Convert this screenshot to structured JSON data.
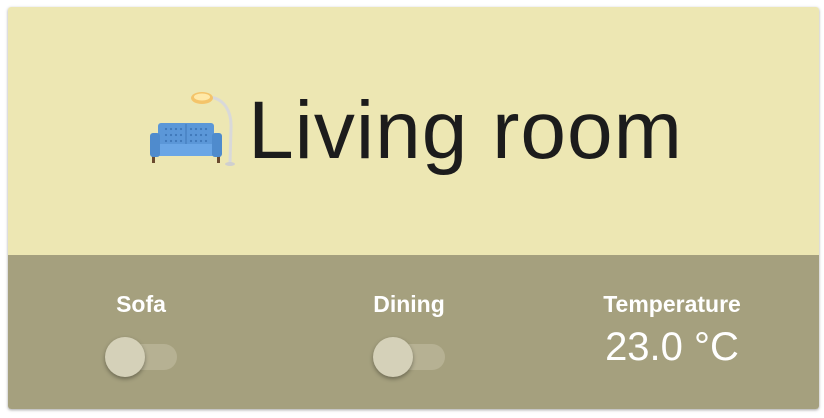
{
  "header": {
    "title": "Living room",
    "icon": "couch-and-lamp-icon",
    "background": "#ede7b3"
  },
  "footer": {
    "background": "#a5a07e",
    "sofa": {
      "label": "Sofa",
      "state": "off"
    },
    "dining": {
      "label": "Dining",
      "state": "off"
    },
    "temperature": {
      "label": "Temperature",
      "value": "23.0 °C"
    }
  }
}
